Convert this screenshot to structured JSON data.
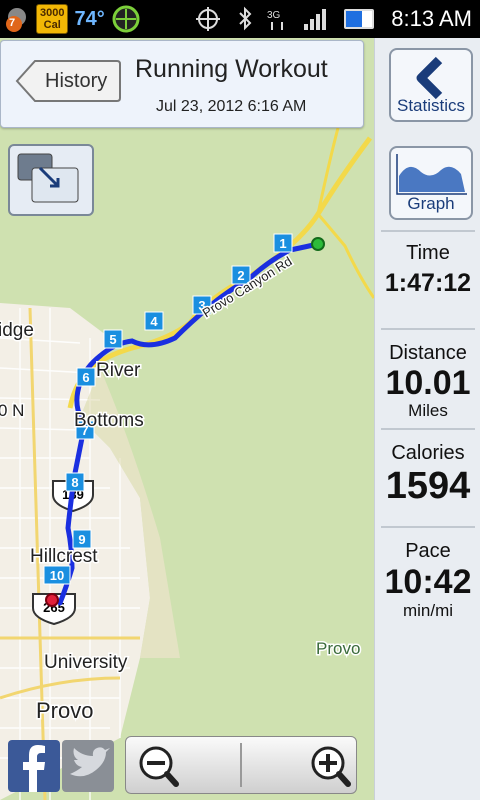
{
  "status_bar": {
    "notification_count": "7",
    "calories_badge_line1": "3000",
    "calories_badge_line2": "Cal",
    "temperature": "74°",
    "time": "8:13 AM"
  },
  "header": {
    "back_label": "History",
    "title": "Running Workout",
    "datetime": "Jul 23, 2012 6:16 AM"
  },
  "side_panel": {
    "statistics_label": "Statistics",
    "graph_label": "Graph",
    "time": {
      "label": "Time",
      "value": "1:47:12"
    },
    "distance": {
      "label": "Distance",
      "value": "10.01",
      "unit": "Miles"
    },
    "calories": {
      "label": "Calories",
      "value": "1594"
    },
    "pace": {
      "label": "Pace",
      "value": "10:42",
      "unit": "min/mi"
    }
  },
  "map": {
    "route_color": "#1a2fe0",
    "start_color": "#2dbb3a",
    "end_color": "#e0203a",
    "mile_markers": [
      "1",
      "2",
      "3",
      "4",
      "5",
      "6",
      "7",
      "8",
      "9",
      "10"
    ],
    "labels": {
      "ridge": "idge",
      "n0": "0 N",
      "river_bottoms_1": "River",
      "river_bottoms_2": "Bottoms",
      "hillcrest": "Hillcrest",
      "university": "University",
      "provo": "Provo",
      "provo_e": "Provo",
      "highway_189": "189",
      "highway_265": "265",
      "road_name": "Provo Canyon Rd"
    }
  }
}
